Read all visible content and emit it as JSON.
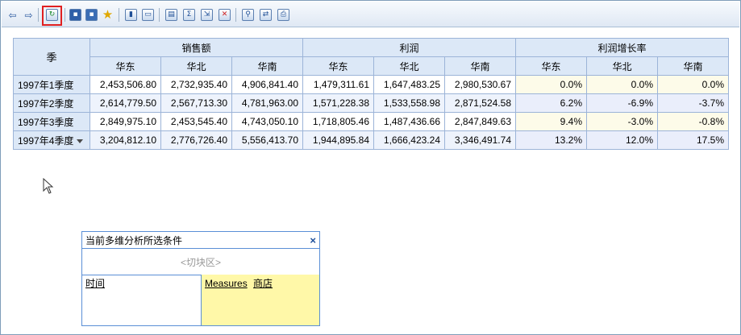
{
  "toolbar": {
    "buttons": [
      {
        "name": "back-icon",
        "glyph": "⇦"
      },
      {
        "name": "forward-icon",
        "glyph": "⇨"
      },
      {
        "name": "refresh-icon",
        "glyph": "↻"
      },
      {
        "name": "save-icon",
        "glyph": "▪"
      },
      {
        "name": "save-as-icon",
        "glyph": "▪"
      },
      {
        "name": "favorite-icon",
        "glyph": "★"
      },
      {
        "name": "chart-icon",
        "glyph": "▮"
      },
      {
        "name": "window-icon",
        "glyph": "▭"
      },
      {
        "name": "export-icon",
        "glyph": "▤"
      },
      {
        "name": "sum-icon",
        "glyph": "Σ"
      },
      {
        "name": "drill-icon",
        "glyph": "⇲"
      },
      {
        "name": "delete-row-icon",
        "glyph": "✕"
      },
      {
        "name": "search-icon",
        "glyph": "⚲"
      },
      {
        "name": "swap-axes-icon",
        "glyph": "⇄"
      },
      {
        "name": "print-icon",
        "glyph": "⎙"
      }
    ]
  },
  "table": {
    "corner": "季",
    "groups": [
      "销售额",
      "利润",
      "利润增长率"
    ],
    "regions": [
      "华东",
      "华北",
      "华南"
    ],
    "rows": [
      {
        "label": "1997年1季度",
        "sales": [
          "2,453,506.80",
          "2,732,935.40",
          "4,906,841.40"
        ],
        "profit": [
          "1,479,311.61",
          "1,647,483.25",
          "2,980,530.67"
        ],
        "growth": [
          "0.0%",
          "0.0%",
          "0.0%"
        ]
      },
      {
        "label": "1997年2季度",
        "sales": [
          "2,614,779.50",
          "2,567,713.30",
          "4,781,963.00"
        ],
        "profit": [
          "1,571,228.38",
          "1,533,558.98",
          "2,871,524.58"
        ],
        "growth": [
          "6.2%",
          "-6.9%",
          "-3.7%"
        ]
      },
      {
        "label": "1997年3季度",
        "sales": [
          "2,849,975.10",
          "2,453,545.40",
          "4,743,050.10"
        ],
        "profit": [
          "1,718,805.46",
          "1,487,436.66",
          "2,847,849.63"
        ],
        "growth": [
          "9.4%",
          "-3.0%",
          "-0.8%"
        ]
      },
      {
        "label": "1997年4季度",
        "sales": [
          "3,204,812.10",
          "2,776,726.40",
          "5,556,413.70"
        ],
        "profit": [
          "1,944,895.84",
          "1,666,423.24",
          "3,346,491.74"
        ],
        "growth": [
          "13.2%",
          "12.0%",
          "17.5%"
        ]
      }
    ]
  },
  "panel": {
    "title": "当前多维分析所选条件",
    "close": "×",
    "slicer": "<切块区>",
    "left_link": "时间",
    "right_links": [
      "Measures",
      "商店"
    ]
  }
}
